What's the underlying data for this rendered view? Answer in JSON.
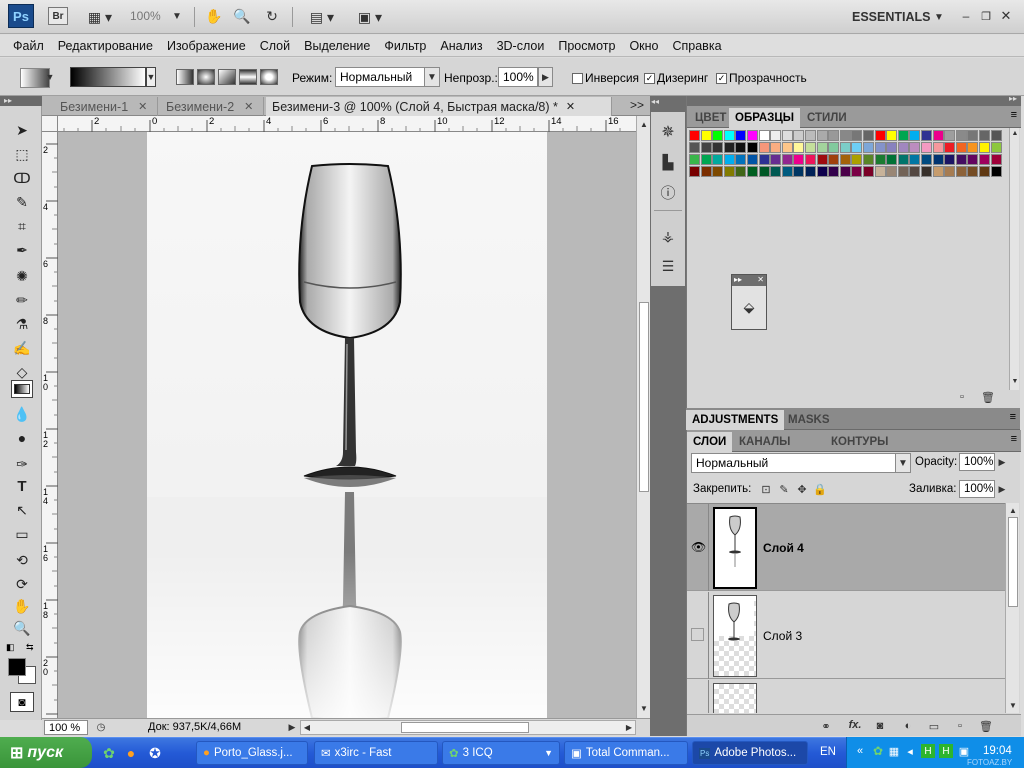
{
  "app": {
    "logo": "Ps",
    "bridge": "Br",
    "zoom": "100%",
    "workspace": "ESSENTIALS"
  },
  "menu": [
    "Файл",
    "Редактирование",
    "Изображение",
    "Слой",
    "Выделение",
    "Фильтр",
    "Анализ",
    "3D-слои",
    "Просмотр",
    "Окно",
    "Справка"
  ],
  "options": {
    "mode_label": "Режим:",
    "mode_value": "Нормальный",
    "opacity_label": "Непрозр.:",
    "opacity_value": "100%",
    "inverse_label": "Инверсия",
    "dither_label": "Дизеринг",
    "transparency_label": "Прозрачность"
  },
  "document": {
    "tabs": [
      "Безимени-1",
      "Безимени-2",
      "Безимени-3 @ 100% (Слой 4, Быстрая маска/8) *"
    ],
    "ruler_top": [
      "2",
      "0",
      "2",
      "4",
      "6",
      "8",
      "10",
      "12",
      "14",
      "16"
    ],
    "ruler_left": [
      "2",
      "4",
      "6",
      "8",
      "1\n0",
      "1\n2",
      "1\n4",
      "1\n6",
      "1\n8",
      "2\n0",
      "2\n2"
    ],
    "status_zoom": "100 %",
    "status_doc": "Док: 937,5K/4,66M"
  },
  "swatches_tabs": [
    "ЦВЕТ",
    "ОБРАЗЦЫ",
    "СТИЛИ"
  ],
  "adjust_tabs": [
    "ADJUSTMENTS",
    "MASKS"
  ],
  "layers": {
    "tabs": [
      "СЛОИ",
      "КАНАЛЫ",
      "КОНТУРЫ"
    ],
    "blend": "Нормальный",
    "opacity_label": "Opacity:",
    "opacity_value": "100%",
    "lock_label": "Закрепить:",
    "fill_label": "Заливка:",
    "fill_value": "100%",
    "items": [
      {
        "name": "Слой 4"
      },
      {
        "name": "Слой 3"
      }
    ]
  },
  "taskbar": {
    "start": "пуск",
    "buttons": [
      "Porto_Glass.j...",
      "x3irc - Fast",
      "3 ICQ",
      "Total Comman...",
      "Adobe Photos..."
    ],
    "lang": "EN",
    "time": "19:04",
    "watermark": "FOTOAZ.BY"
  },
  "colors": {
    "accent": "#245ad6",
    "panel_bg": "#d6d6d6",
    "selected_layer": "#a9a9a9"
  }
}
